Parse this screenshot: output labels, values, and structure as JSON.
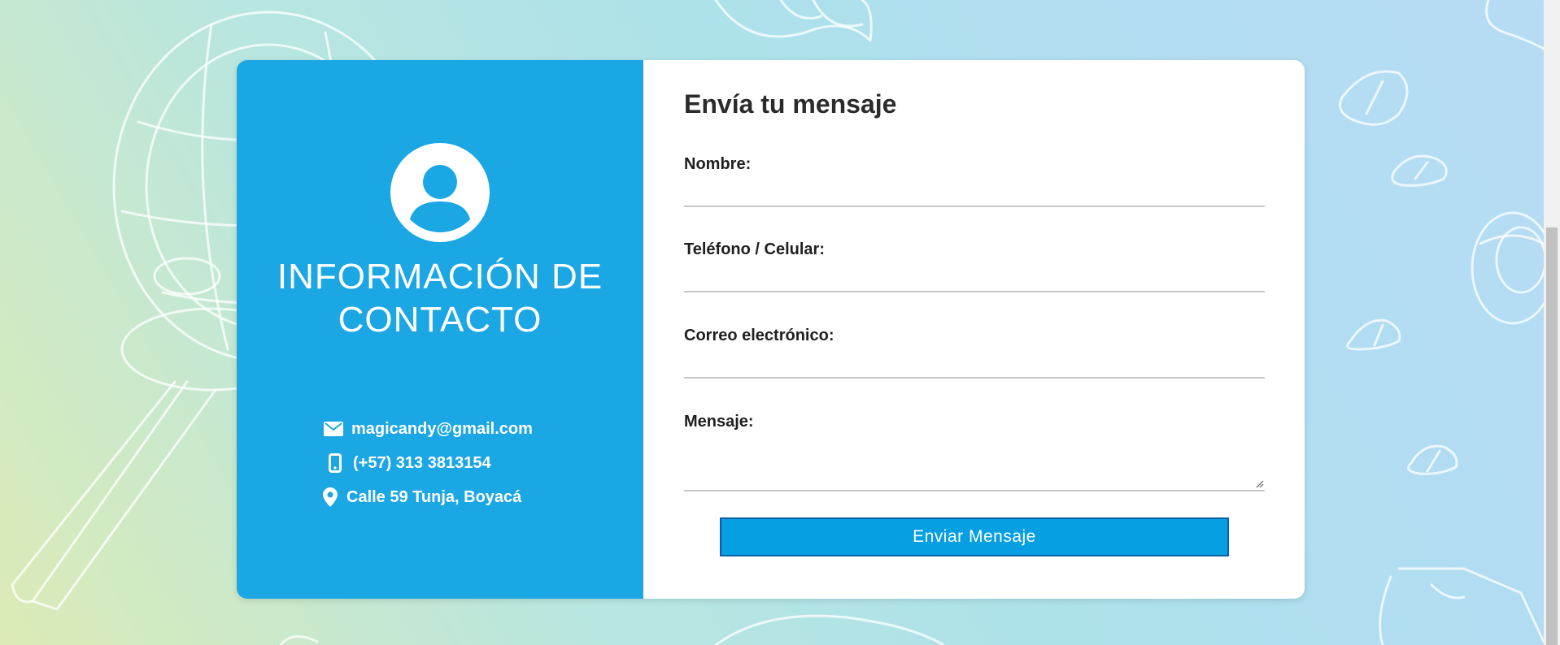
{
  "contact_info": {
    "title": "INFORMACIÓN DE CONTACTO",
    "items": [
      {
        "icon": "envelope-icon",
        "text": "magicandy@gmail.com"
      },
      {
        "icon": "mobile-phone-icon",
        "text": "(+57) 313 3813154"
      },
      {
        "icon": "map-pin-icon",
        "text": "Calle 59 Tunja, Boyacá"
      }
    ]
  },
  "form": {
    "title": "Envía tu mensaje",
    "fields": [
      {
        "label": "Nombre:",
        "value": ""
      },
      {
        "label": "Teléfono / Celular:",
        "value": ""
      },
      {
        "label": "Correo electrónico:",
        "value": ""
      },
      {
        "label": "Mensaje:",
        "value": ""
      }
    ],
    "submit_label": "Enviar Mensaje"
  },
  "colors": {
    "info_panel": "#1ba6e4",
    "button": "#059fe2",
    "button_border": "#0d5fa8",
    "title_text": "#2b2b2b"
  }
}
